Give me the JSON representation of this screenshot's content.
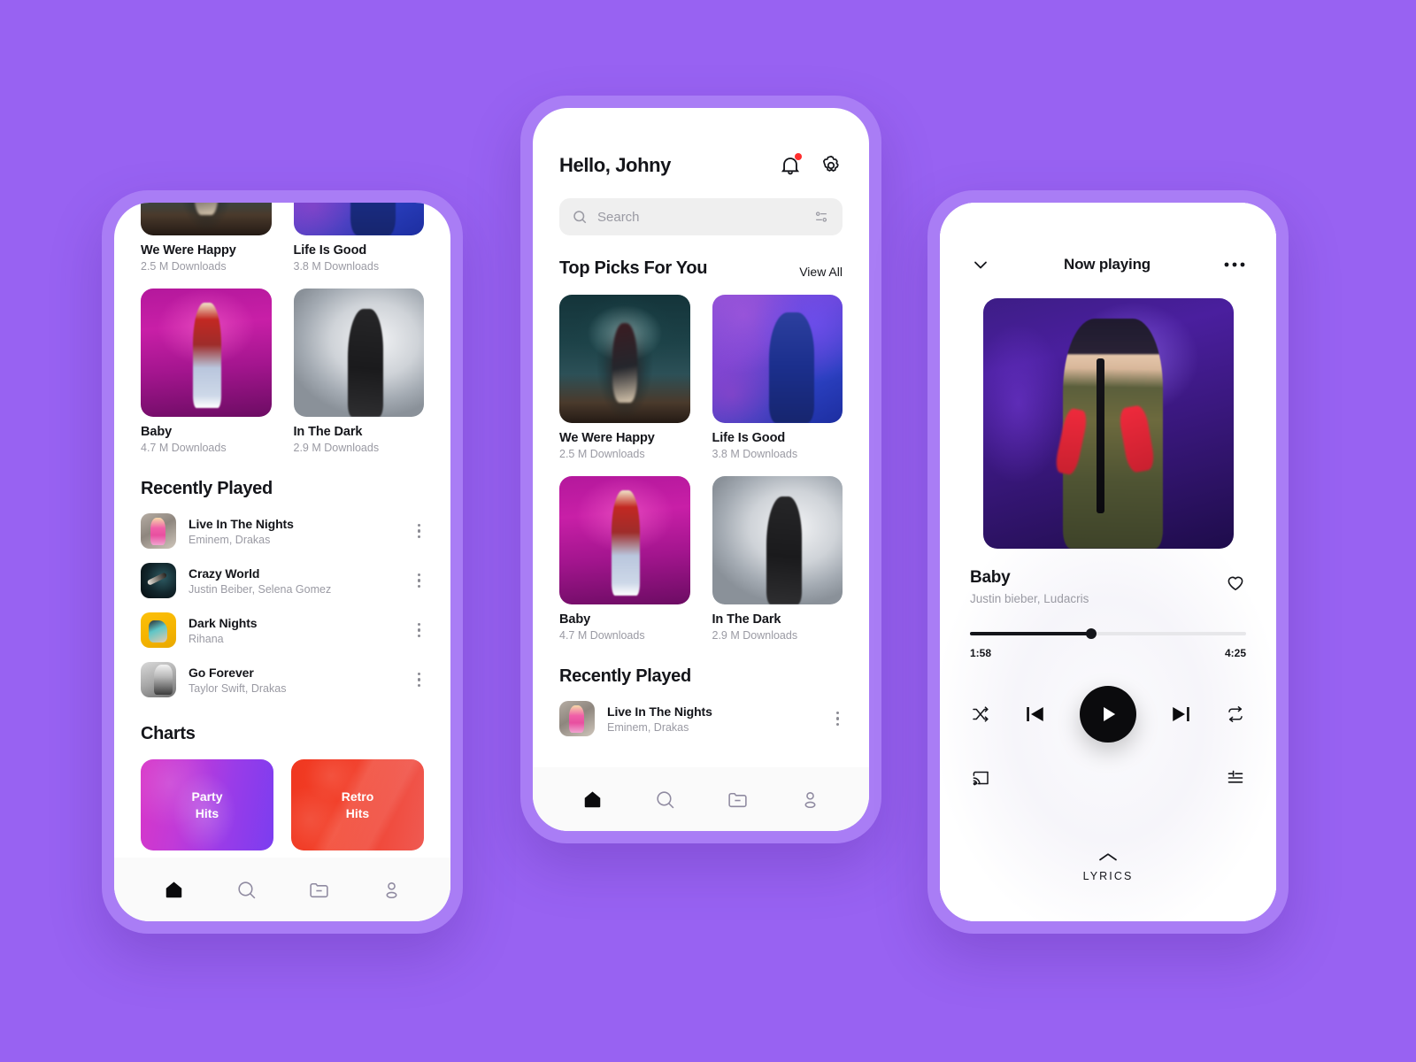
{
  "theme": {
    "background": "#9862F2",
    "phone_frame": "#A97DF5",
    "screen": "#FFFFFF",
    "text_primary": "#14151A",
    "text_muted": "#9A9AA3",
    "search_bg": "#EFEFEF",
    "nav_bg": "#FAFAFA",
    "notification_dot": "#FF2D2D",
    "accent_party": "#C13AD8",
    "accent_retro": "#F0371F"
  },
  "home_screen": {
    "greeting": "Hello, Johny",
    "icons": {
      "notifications": "bell-icon",
      "settings": "gear-icon"
    },
    "search": {
      "placeholder": "Search",
      "value": "",
      "leading_icon": "search-icon",
      "trailing_icon": "filter-sliders-icon"
    },
    "top_picks": {
      "title": "Top Picks For You",
      "view_all": "View All",
      "items": [
        {
          "title": "We Were Happy",
          "subtitle": "2.5 M Downloads",
          "art": "ph-guitar"
        },
        {
          "title": "Life Is Good",
          "subtitle": "3.8 M Downloads",
          "art": "ph-blue"
        },
        {
          "title": "Baby",
          "subtitle": "4.7 M Downloads",
          "art": "ph-pink"
        },
        {
          "title": "In The Dark",
          "subtitle": "2.9 M Downloads",
          "art": "ph-gray"
        }
      ]
    },
    "recently_played": {
      "title": "Recently Played",
      "items": [
        {
          "title": "Live In The Nights",
          "artists": "Eminem, Drakas",
          "art": "rt-a"
        },
        {
          "title": "Crazy World",
          "artists": "Justin Beiber, Selena Gomez",
          "art": "rt-b"
        },
        {
          "title": "Dark Nights",
          "artists": "Rihana",
          "art": "rt-c"
        },
        {
          "title": "Go Forever",
          "artists": "Taylor Swift, Drakas",
          "art": "rt-d"
        }
      ]
    },
    "charts": {
      "title": "Charts",
      "items": [
        {
          "line1": "Party",
          "line2": "Hits",
          "style": "cc-party"
        },
        {
          "line1": "Retro",
          "line2": "Hits",
          "style": "cc-retro"
        }
      ]
    },
    "bottom_nav": {
      "active_index": 0,
      "items": [
        {
          "name": "home-icon",
          "label": "Home"
        },
        {
          "name": "search-icon",
          "label": "Search"
        },
        {
          "name": "library-icon",
          "label": "Library"
        },
        {
          "name": "profile-icon",
          "label": "Profile"
        }
      ]
    }
  },
  "player_screen": {
    "header": {
      "collapse_icon": "chevron-down-icon",
      "title": "Now playing",
      "more_icon": "more-horizontal-icon"
    },
    "artwork": "justin-bieber-performing",
    "song": {
      "title": "Baby",
      "artists": "Justin bieber, Ludacris",
      "favorite_icon": "heart-icon",
      "favorited": false
    },
    "progress": {
      "elapsed": "1:58",
      "total": "4:25",
      "percent": 44
    },
    "controls": {
      "shuffle": "shuffle-icon",
      "previous": "skip-previous-icon",
      "play": "play-icon",
      "next": "skip-next-icon",
      "repeat": "repeat-icon",
      "cast": "cast-icon",
      "queue": "queue-list-icon"
    },
    "lyrics": {
      "chevron": "chevron-up-icon",
      "label": "LYRICS"
    }
  }
}
